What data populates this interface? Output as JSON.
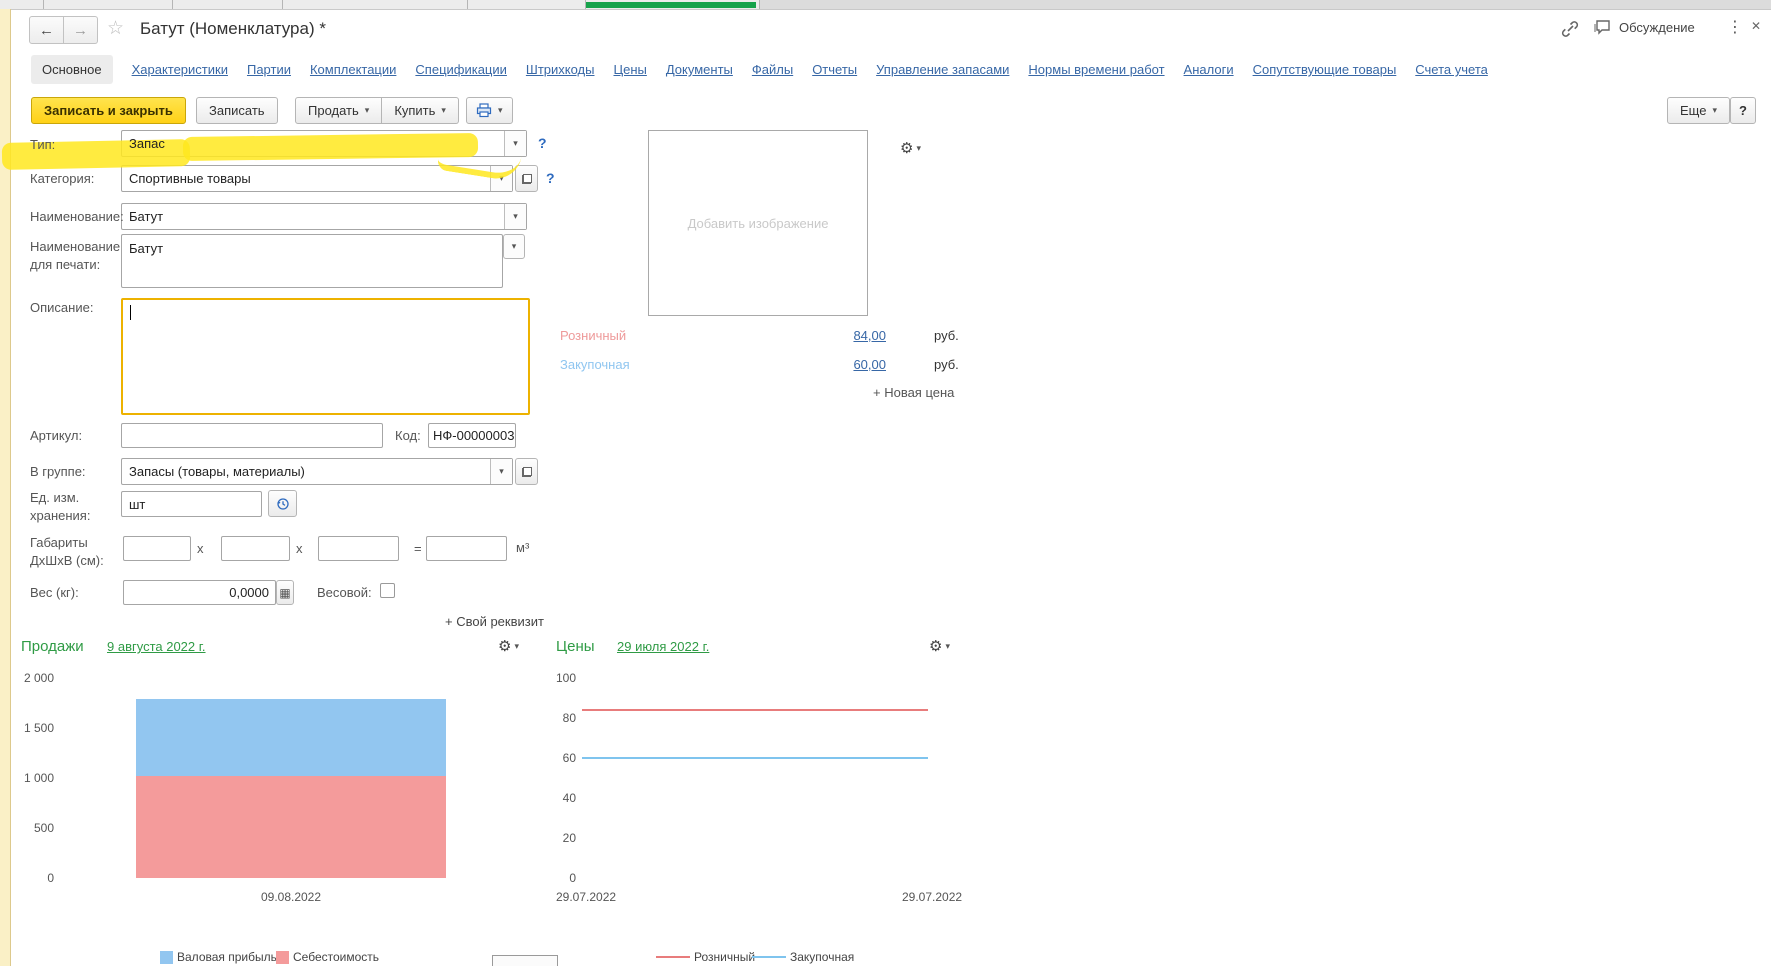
{
  "window": {
    "title": "Батут (Номенклатура) *",
    "discussion": "Обсуждение"
  },
  "icons": {
    "back": "←",
    "forward": "→",
    "star": "☆",
    "dropdown": "▾",
    "dots": "⋮",
    "close": "✕",
    "help": "?",
    "gear": "⚙",
    "calc": "▦"
  },
  "tabs": [
    {
      "label": "Основное",
      "active": true
    },
    {
      "label": "Характеристики",
      "active": false
    },
    {
      "label": "Партии",
      "active": false
    },
    {
      "label": "Комплектации",
      "active": false
    },
    {
      "label": "Спецификации",
      "active": false
    },
    {
      "label": "Штрихкоды",
      "active": false
    },
    {
      "label": "Цены",
      "active": false
    },
    {
      "label": "Документы",
      "active": false
    },
    {
      "label": "Файлы",
      "active": false
    },
    {
      "label": "Отчеты",
      "active": false
    },
    {
      "label": "Управление запасами",
      "active": false
    },
    {
      "label": "Нормы времени работ",
      "active": false
    },
    {
      "label": "Аналоги",
      "active": false
    },
    {
      "label": "Сопутствующие товары",
      "active": false
    },
    {
      "label": "Счета учета",
      "active": false
    }
  ],
  "toolbar": {
    "save_and_close": "Записать и закрыть",
    "save": "Записать",
    "sell": "Продать",
    "buy": "Купить",
    "more": "Еще",
    "help": "?"
  },
  "fields": {
    "type": {
      "label": "Тип:",
      "value": "Запас"
    },
    "category": {
      "label": "Категория:",
      "value": "Спортивные товары"
    },
    "name": {
      "label": "Наименование:",
      "value": "Батут"
    },
    "print_name": {
      "label": "Наименование для печати:",
      "value": "Батут"
    },
    "description": {
      "label": "Описание:",
      "value": ""
    },
    "sku": {
      "label": "Артикул:",
      "value": ""
    },
    "code": {
      "label": "Код:",
      "value": "НФ-00000003"
    },
    "group": {
      "label": "В группе:",
      "value": "Запасы (товары, материалы)"
    },
    "unit": {
      "label": "Ед. изм. хранения:",
      "value": "шт"
    },
    "dimensions": {
      "label": "Габариты ДхШхВ (см):",
      "sep": "x",
      "eq": "=",
      "unit": "м³"
    },
    "weight": {
      "label": "Вес (кг):",
      "value": "0,0000"
    },
    "weighted": {
      "label": "Весовой:",
      "checked": false
    },
    "custom_attr": "+ Свой реквизит"
  },
  "image_box": {
    "placeholder": "Добавить изображение"
  },
  "prices": {
    "rows": [
      {
        "name": "Розничный",
        "value": "84,00",
        "currency": "руб."
      },
      {
        "name": "Закупочная",
        "value": "60,00",
        "currency": "руб."
      }
    ],
    "add": "+ Новая цена"
  },
  "chart_data": [
    {
      "type": "bar",
      "stacked": true,
      "title": "Продажи",
      "date_link": "9 августа 2022 г.",
      "categories": [
        "09.08.2022"
      ],
      "series": [
        {
          "name": "Валовая прибыль",
          "color": "#92c6f0",
          "values": [
            780
          ]
        },
        {
          "name": "Себестоимость",
          "color": "#f49b9b",
          "values": [
            1020
          ]
        }
      ],
      "ylim": [
        0,
        2000
      ],
      "yticks": [
        "2 000",
        "1 500",
        "1 000",
        "500",
        "0"
      ],
      "xlabel": "09.08.2022",
      "legend_position": "bottom",
      "grid": false
    },
    {
      "type": "line",
      "title": "Цены",
      "date_link": "29 июля 2022 г.",
      "x": [
        "29.07.2022",
        "29.07.2022"
      ],
      "series": [
        {
          "name": "Розничный",
          "color": "#e87c7c",
          "values": [
            84,
            84
          ]
        },
        {
          "name": "Закупочная",
          "color": "#7fc4ee",
          "values": [
            60,
            60
          ]
        }
      ],
      "ylim": [
        0,
        100
      ],
      "yticks": [
        "100",
        "80",
        "60",
        "40",
        "20",
        "0"
      ],
      "xlabels": [
        "29.07.2022",
        "29.07.2022"
      ],
      "legend_position": "bottom",
      "grid": false
    }
  ]
}
